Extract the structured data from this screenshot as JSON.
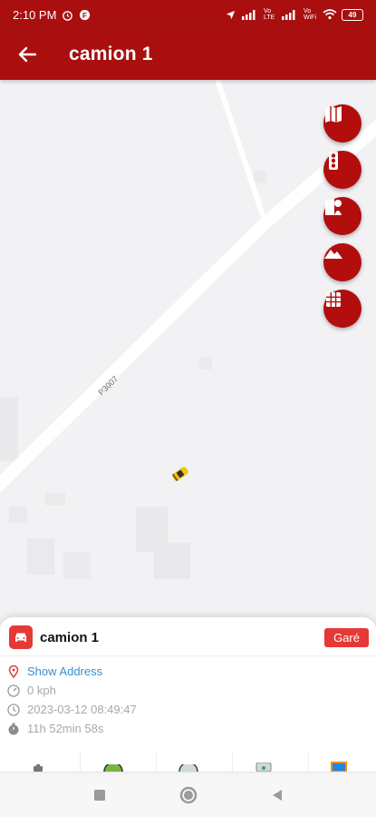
{
  "status_bar": {
    "time": "2:10 PM",
    "signal_labels": [
      "Vo LTE",
      "Vo WiFi"
    ],
    "battery": "49"
  },
  "app_bar": {
    "title": "camion 1",
    "back_icon": "arrow-left-icon"
  },
  "map": {
    "road_label": "P3007",
    "buttons": [
      {
        "icon": "map-layers-icon"
      },
      {
        "icon": "traffic-light-icon"
      },
      {
        "icon": "street-view-icon"
      },
      {
        "icon": "terrain-icon"
      },
      {
        "icon": "grid-icon"
      }
    ],
    "vehicle_icon": "car-marker-icon"
  },
  "vehicle_panel": {
    "name": "camion 1",
    "status": "Garé",
    "address_link": "Show Address",
    "speed": "0 kph",
    "datetime": "2023-03-12 08:49:47",
    "duration": "11h 52min 58s"
  },
  "colors": {
    "primary": "#a90f0f",
    "status_badge": "#e53935",
    "link": "#3a8fd0"
  }
}
